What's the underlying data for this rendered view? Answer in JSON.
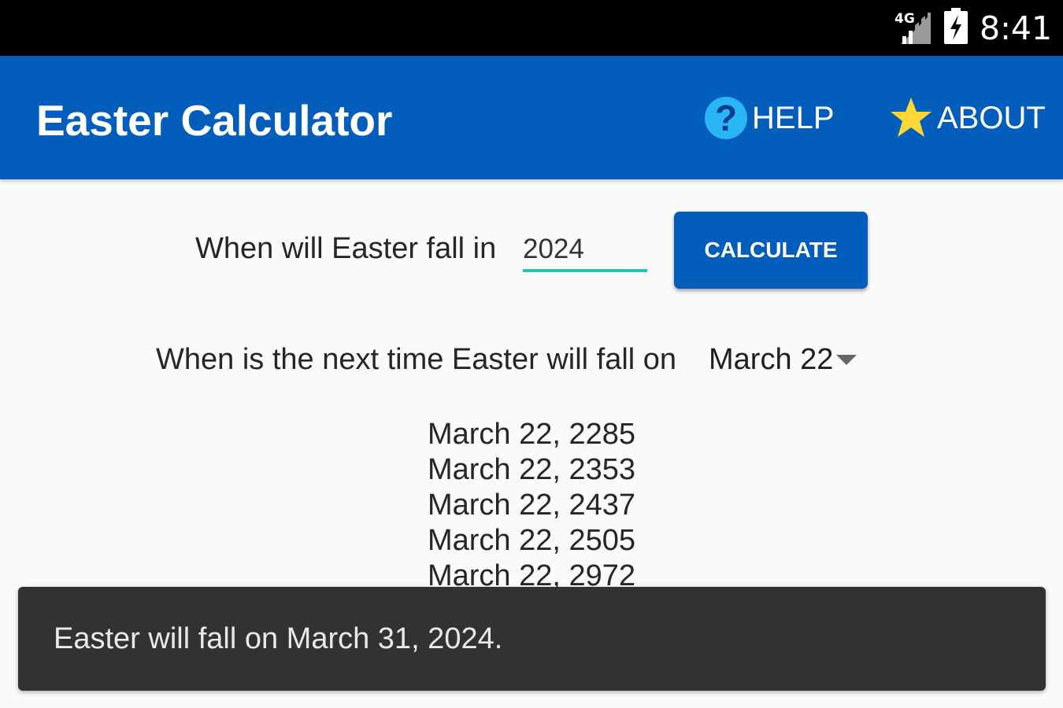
{
  "status_bar": {
    "network": "4G",
    "clock": "8:41",
    "icons": [
      "signal-icon",
      "battery-charging-icon"
    ]
  },
  "app_bar": {
    "title": "Easter Calculator",
    "background": "#035dbb",
    "actions": [
      {
        "label": "HELP",
        "icon": "help-icon",
        "icon_color": "#29b6f6"
      },
      {
        "label": "ABOUT",
        "icon": "star-icon",
        "icon_color": "#fdd835"
      }
    ]
  },
  "year_query": {
    "label": "When will Easter fall in",
    "input_value": "2024",
    "button_label": "CALCULATE",
    "accent": "#26c6b3"
  },
  "date_query": {
    "label": "When is the next time Easter will fall on",
    "selected": "March 22"
  },
  "results": [
    "March 22, 2285",
    "March 22, 2353",
    "March 22, 2437",
    "March 22, 2505",
    "March 22, 2972"
  ],
  "snackbar": {
    "message": "Easter will fall on March 31, 2024."
  }
}
